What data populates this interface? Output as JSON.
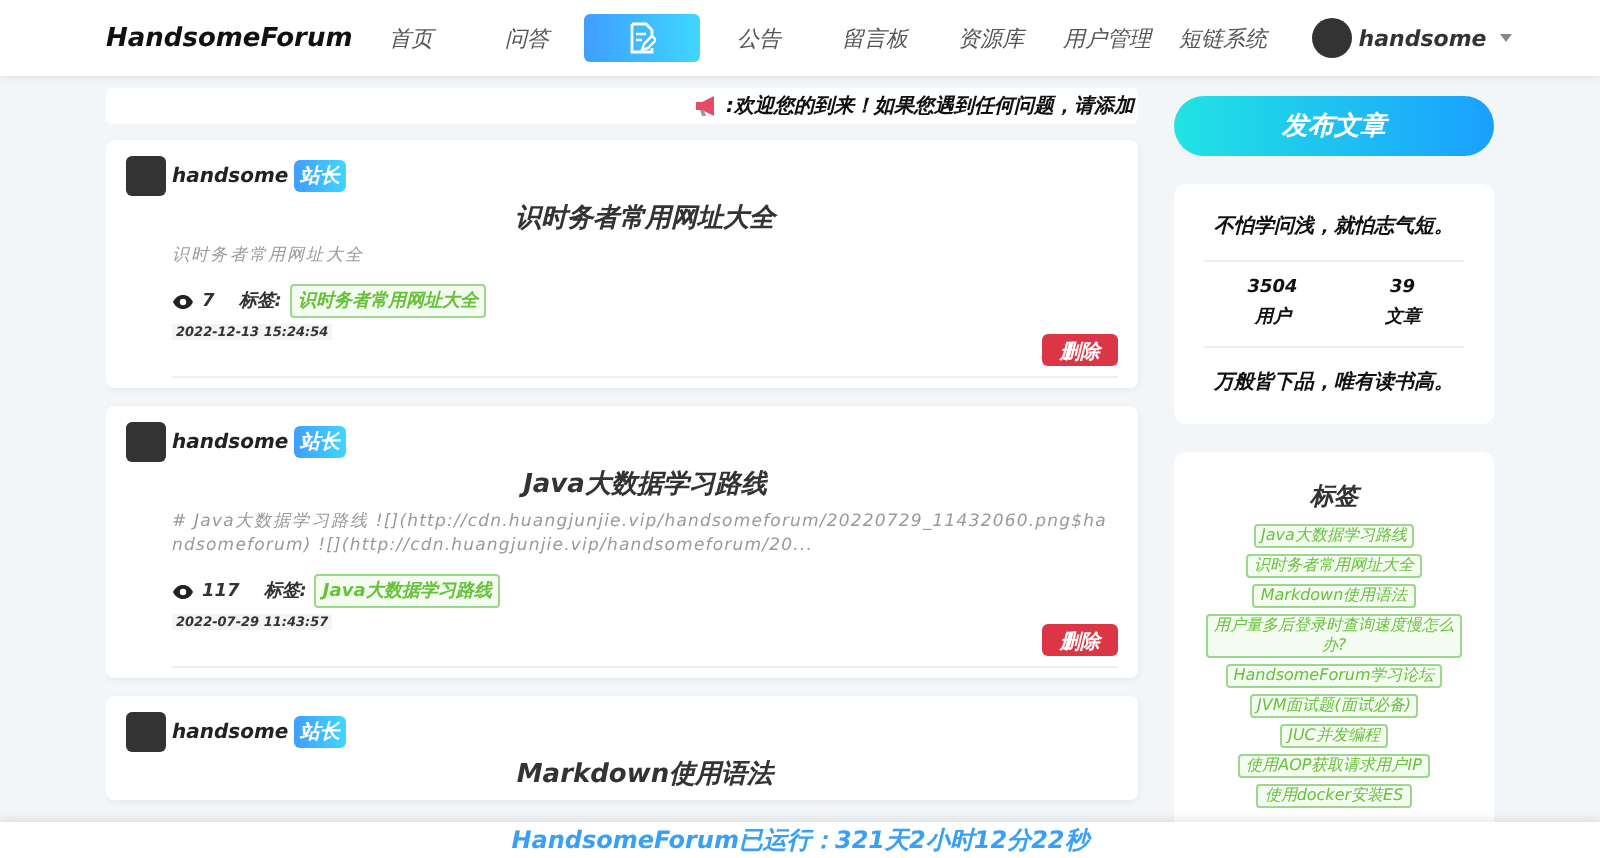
{
  "header": {
    "logo": "HandsomeForum",
    "nav": [
      {
        "kind": "text",
        "label": "首页",
        "selected": false
      },
      {
        "kind": "text",
        "label": "问答",
        "selected": false
      },
      {
        "kind": "icon",
        "selected": true
      },
      {
        "kind": "text",
        "label": "公告",
        "selected": false
      },
      {
        "kind": "text",
        "label": "留言板",
        "selected": false
      },
      {
        "kind": "text",
        "label": "资源库",
        "selected": false
      },
      {
        "kind": "text",
        "label": "用户管理",
        "selected": false
      },
      {
        "kind": "text",
        "label": "短链系统",
        "selected": false
      }
    ],
    "user": {
      "name": "handsome"
    }
  },
  "announcement": ":欢迎您的到来！如果您遇到任何问题，请添加",
  "posts": [
    {
      "author": "handsome",
      "badge": "站长",
      "title": "识时务者常用网址大全",
      "summary": "识时务者常用网址大全",
      "views": "7",
      "tags_label": "标签:",
      "tags": [
        "识时务者常用网址大全"
      ],
      "date": "2022-12-13 15:24:54",
      "action": "删除"
    },
    {
      "author": "handsome",
      "badge": "站长",
      "title": "Java大数据学习路线",
      "summary": "# Java大数据学习路线 ![](http://cdn.huangjunjie.vip/handsomeforum/20220729_11432060.png$handsomeforum) ![](http://cdn.huangjunjie.vip/handsomeforum/20...",
      "views": "117",
      "tags_label": "标签:",
      "tags": [
        "Java大数据学习路线"
      ],
      "date": "2022-07-29 11:43:57",
      "action": "删除"
    },
    {
      "author": "handsome",
      "badge": "站长",
      "title": "Markdown使用语法"
    }
  ],
  "sidebar": {
    "publish_button": "发布文章",
    "motto_top": "不怕学问浅，就怕志气短。",
    "stats": [
      {
        "value": "3504",
        "label": "用户"
      },
      {
        "value": "39",
        "label": "文章"
      }
    ],
    "motto_bottom": "万般皆下品，唯有读书高。",
    "tags_title": "标签",
    "tags": [
      "Java大数据学习路线",
      "识时务者常用网址大全",
      "Markdown使用语法",
      "用户量多后登录时查询速度慢怎么办?",
      "HandsomeForum学习论坛",
      "JVM面试题(面试必备)",
      "JUC并发编程",
      "使用AOP获取请求用户IP",
      "使用docker安装ES"
    ]
  },
  "footer": "HandsomeForum已运行：321天2小时12分22秒"
}
